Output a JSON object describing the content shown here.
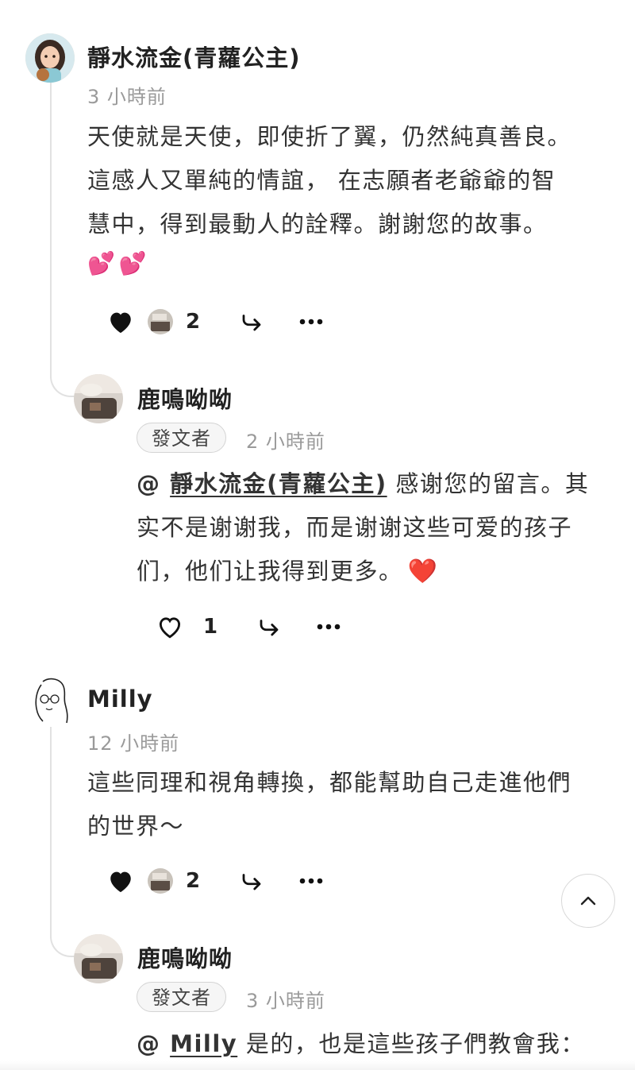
{
  "comments": [
    {
      "author": "靜水流金(青蘿公主)",
      "time": "3 小時前",
      "lines": [
        "天使就是天使，即使折了翼，仍然純真善良。",
        "這感人又單純的情誼， 在志願者老爺爺的智",
        "慧中，得到最動人的詮釋。謝謝您的故事。"
      ],
      "emoji": "💕 💕",
      "like_count": "2",
      "liked": true,
      "reply": {
        "author": "鹿鳴呦呦",
        "badge": "發文者",
        "time": "2 小時前",
        "mention_prefix": "@ ",
        "mention": "靜水流金(青蘿公主)",
        "lines": [
          " 感谢您的留言。其",
          "实不是谢谢我，而是谢谢这些可爱的孩子",
          "们，他们让我得到更多。"
        ],
        "end_emoji": "❤️",
        "like_count": "1",
        "liked": false
      }
    },
    {
      "author": "Milly",
      "time": "12 小時前",
      "lines": [
        "這些同理和視角轉換，都能幫助自己走進他們",
        "的世界～"
      ],
      "like_count": "2",
      "liked": true,
      "reply": {
        "author": "鹿鳴呦呦",
        "badge": "發文者",
        "time": "3 小時前",
        "mention_prefix": "@ ",
        "mention": "Milly",
        "lines": [
          " 是的，也是這些孩子們教會我："
        ]
      }
    }
  ],
  "colors": {
    "text": "#2b2b2b",
    "muted": "#9a9a9a",
    "heart_emoji": "#e8333a",
    "pink": "#ff4fa3"
  },
  "icons": [
    "heart-filled-icon",
    "heart-outline-icon",
    "share-arrow-icon",
    "more-dots-icon",
    "chevron-up-icon"
  ]
}
